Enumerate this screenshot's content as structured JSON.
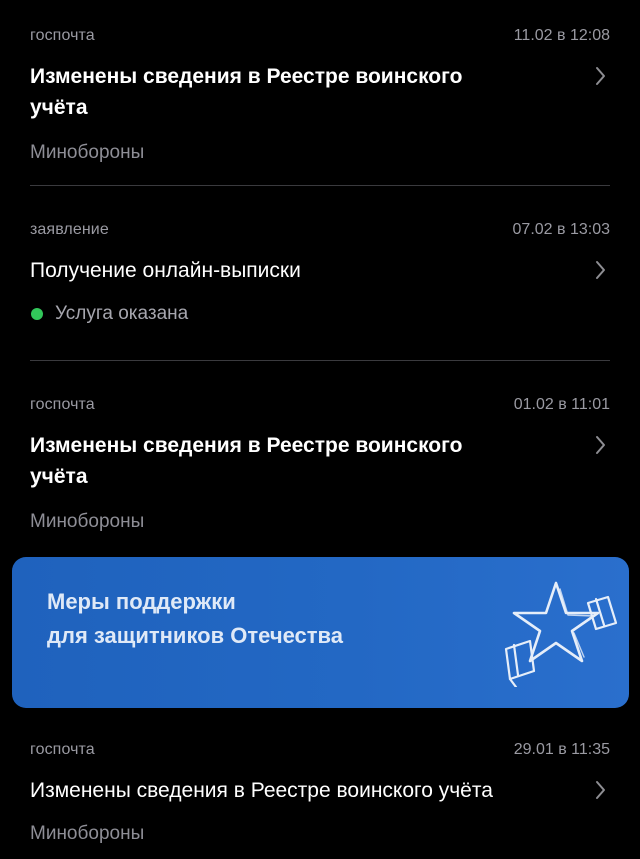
{
  "feed": [
    {
      "type": "госпочта",
      "date": "11.02 в 12:08",
      "title": "Изменены сведения в Реестре воинского учёта",
      "title_line1": "Изменены сведения в Реестре воинского",
      "title_line2": "учёта",
      "subtitle": "Минобороны"
    },
    {
      "type": "заявление",
      "date": "07.02 в 13:03",
      "title": "Получение онлайн-выписки",
      "status": "Услуга оказана",
      "status_color": "#32c75a"
    },
    {
      "type": "госпочта",
      "date": "01.02 в 11:01",
      "title_line1": "Изменены сведения в Реестре воинского",
      "title_line2": "учёта",
      "subtitle": "Минобороны"
    },
    {
      "type": "госпочта",
      "date": "29.01 в 11:35",
      "title": "Изменены сведения в Реестре воинского учёта",
      "subtitle": "Минобороны"
    }
  ],
  "banner": {
    "line1": "Меры поддержки",
    "line2": "для защитников Отечества",
    "icon": "star-flag-icon",
    "background": "#2166c2"
  },
  "icons": {
    "chevron": "chevron-right-icon"
  },
  "colors": {
    "background": "#000000",
    "muted_text": "#9a9aa2",
    "divider": "#3a3a3e"
  }
}
